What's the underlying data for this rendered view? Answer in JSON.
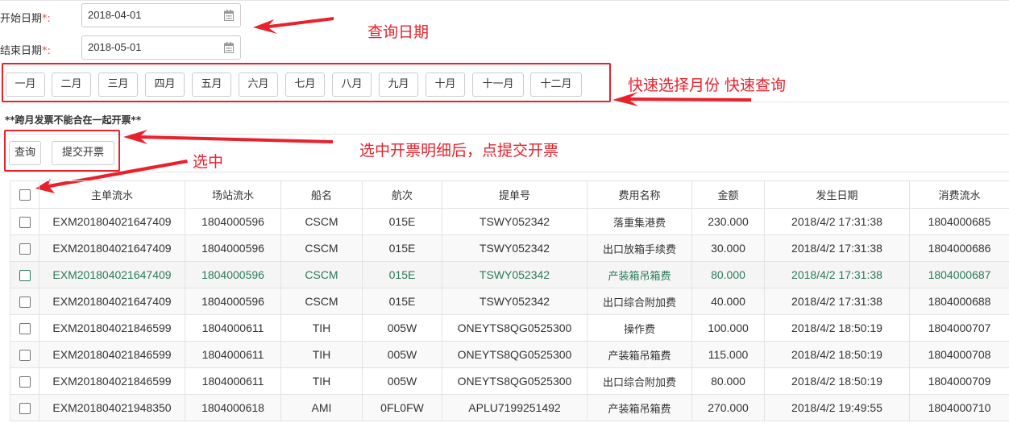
{
  "form": {
    "start_label": "开始日期",
    "start_value": "2018-04-01",
    "end_label": "结束日期",
    "end_value": "2018-05-01",
    "required_mark": "*:"
  },
  "months": [
    "一月",
    "二月",
    "三月",
    "四月",
    "五月",
    "六月",
    "七月",
    "八月",
    "九月",
    "十月",
    "十一月",
    "十二月"
  ],
  "warning": "**跨月发票不能合在一起开票**",
  "actions": {
    "query_label": "查询",
    "submit_label": "提交开票"
  },
  "annotations": {
    "date_query": "查询日期",
    "month_select": "快速选择月份 快速查询",
    "submit_hint": "选中开票明细后，点提交开票",
    "select_hint": "选中"
  },
  "table": {
    "columns": [
      "主单流水",
      "场站流水",
      "船名",
      "航次",
      "提单号",
      "费用名称",
      "金额",
      "发生日期",
      "消费流水"
    ],
    "rows": [
      [
        "EXM201804021647409",
        "1804000596",
        "CSCM",
        "015E",
        "TSWY052342",
        "落重集港费",
        "230.000",
        "2018/4/2 17:31:38",
        "1804000685"
      ],
      [
        "EXM201804021647409",
        "1804000596",
        "CSCM",
        "015E",
        "TSWY052342",
        "出口放箱手续费",
        "30.000",
        "2018/4/2 17:31:38",
        "1804000686"
      ],
      [
        "EXM201804021647409",
        "1804000596",
        "CSCM",
        "015E",
        "TSWY052342",
        "产装箱吊箱费",
        "80.000",
        "2018/4/2 17:31:38",
        "1804000687"
      ],
      [
        "EXM201804021647409",
        "1804000596",
        "CSCM",
        "015E",
        "TSWY052342",
        "出口综合附加费",
        "40.000",
        "2018/4/2 17:31:38",
        "1804000688"
      ],
      [
        "EXM201804021846599",
        "1804000611",
        "TIH",
        "005W",
        "ONEYTS8QG0525300",
        "操作费",
        "100.000",
        "2018/4/2 18:50:19",
        "1804000707"
      ],
      [
        "EXM201804021846599",
        "1804000611",
        "TIH",
        "005W",
        "ONEYTS8QG0525300",
        "产装箱吊箱费",
        "115.000",
        "2018/4/2 18:50:19",
        "1804000708"
      ],
      [
        "EXM201804021846599",
        "1804000611",
        "TIH",
        "005W",
        "ONEYTS8QG0525300",
        "出口综合附加费",
        "80.000",
        "2018/4/2 18:50:19",
        "1804000709"
      ],
      [
        "EXM201804021948350",
        "1804000618",
        "AMI",
        "0FL0FW",
        "APLU7199251492",
        "产装箱吊箱费",
        "270.000",
        "2018/4/2 19:49:55",
        "1804000710"
      ]
    ],
    "highlight_row": 2
  },
  "colors": {
    "annotation_red": "#e8212b",
    "highlight_green": "#2a7a58"
  }
}
